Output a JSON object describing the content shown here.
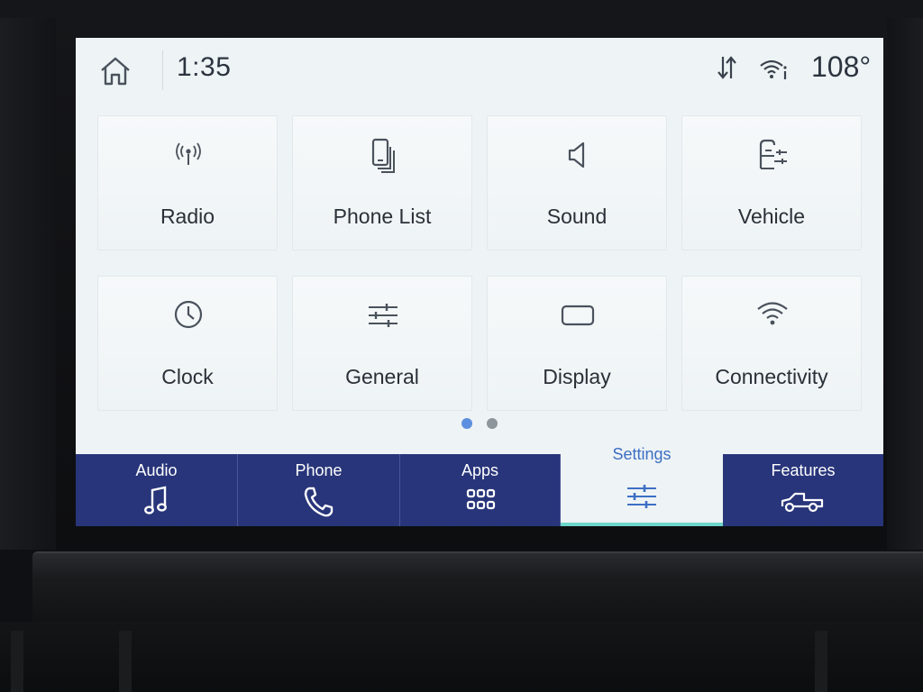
{
  "status_bar": {
    "time": "1:35",
    "temperature": "108°",
    "home_icon": "home-icon",
    "data_icon": "data-transfer-icon",
    "wifi_icon": "wifi-info-icon"
  },
  "settings_grid": [
    {
      "label": "Radio",
      "icon": "radio-antenna-icon"
    },
    {
      "label": "Phone List",
      "icon": "phone-list-icon"
    },
    {
      "label": "Sound",
      "icon": "speaker-icon"
    },
    {
      "label": "Vehicle",
      "icon": "vehicle-icon"
    },
    {
      "label": "Clock",
      "icon": "clock-icon"
    },
    {
      "label": "General",
      "icon": "sliders-icon"
    },
    {
      "label": "Display",
      "icon": "display-icon"
    },
    {
      "label": "Connectivity",
      "icon": "wifi-icon"
    }
  ],
  "pager": {
    "current_page": 1,
    "total_pages": 2
  },
  "bottom_nav": [
    {
      "label": "Audio",
      "icon": "music-note-icon",
      "active": false
    },
    {
      "label": "Phone",
      "icon": "phone-handset-icon",
      "active": false
    },
    {
      "label": "Apps",
      "icon": "apps-grid-icon",
      "active": false
    },
    {
      "label": "Settings",
      "icon": "settings-sliders-icon",
      "active": true
    },
    {
      "label": "Features",
      "icon": "truck-icon",
      "active": false
    }
  ],
  "colors": {
    "nav_background": "#28357a",
    "active_label": "#3d6fc4",
    "active_underline": "#6dd6c9",
    "dot_active": "#5c8fe0",
    "dot_inactive": "#8e959b"
  }
}
